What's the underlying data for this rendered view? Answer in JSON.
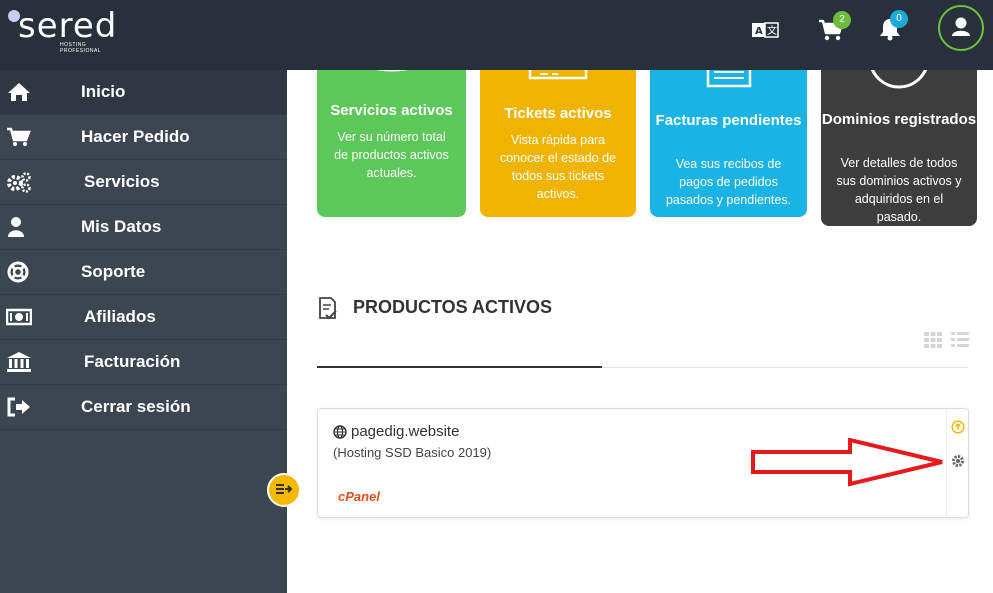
{
  "header": {
    "logo_text": "sered",
    "logo_subtitle": "HOSTING PROFESIONAL",
    "cart_count": "2",
    "notifications_count": "0",
    "colors": {
      "bar": "#27303b",
      "cart_badge": "#6dbd3c",
      "notif_badge": "#1ba9dc",
      "avatar_ring": "#6dbd3c"
    }
  },
  "sidebar": {
    "items": [
      {
        "label": "Inicio",
        "icon": "home-icon"
      },
      {
        "label": "Hacer Pedido",
        "icon": "cart-icon"
      },
      {
        "label": "Servicios",
        "icon": "gears-icon"
      },
      {
        "label": "Mis Datos",
        "icon": "user-icon"
      },
      {
        "label": "Soporte",
        "icon": "lifebuoy-icon"
      },
      {
        "label": "Afiliados",
        "icon": "money-icon"
      },
      {
        "label": "Facturación",
        "icon": "bank-icon"
      },
      {
        "label": "Cerrar sesión",
        "icon": "logout-icon"
      }
    ]
  },
  "cards": [
    {
      "title": "Servicios activos",
      "description": "Ver su número total de productos activos actuales.",
      "color": "#5cc85a"
    },
    {
      "title": "Tickets activos",
      "description": "Vista rápida para conocer el estado de todos sus tickets activos.",
      "color": "#f0b400"
    },
    {
      "title": "Facturas pendientes",
      "description": "Vea sus recibos de pagos de pedidos pasados y pendientes.",
      "color": "#1ab3e6"
    },
    {
      "title": "Dominios registrados",
      "description": "Ver detalles de todos sus dominios activos y adquiridos en el pasado.",
      "color": "#3d3d3d"
    }
  ],
  "products": {
    "section_title": "PRODUCTOS ACTIVOS",
    "items": [
      {
        "domain": "pagedig.website",
        "plan": "(Hosting SSD Basico 2019)",
        "panel": "cPanel"
      }
    ]
  }
}
